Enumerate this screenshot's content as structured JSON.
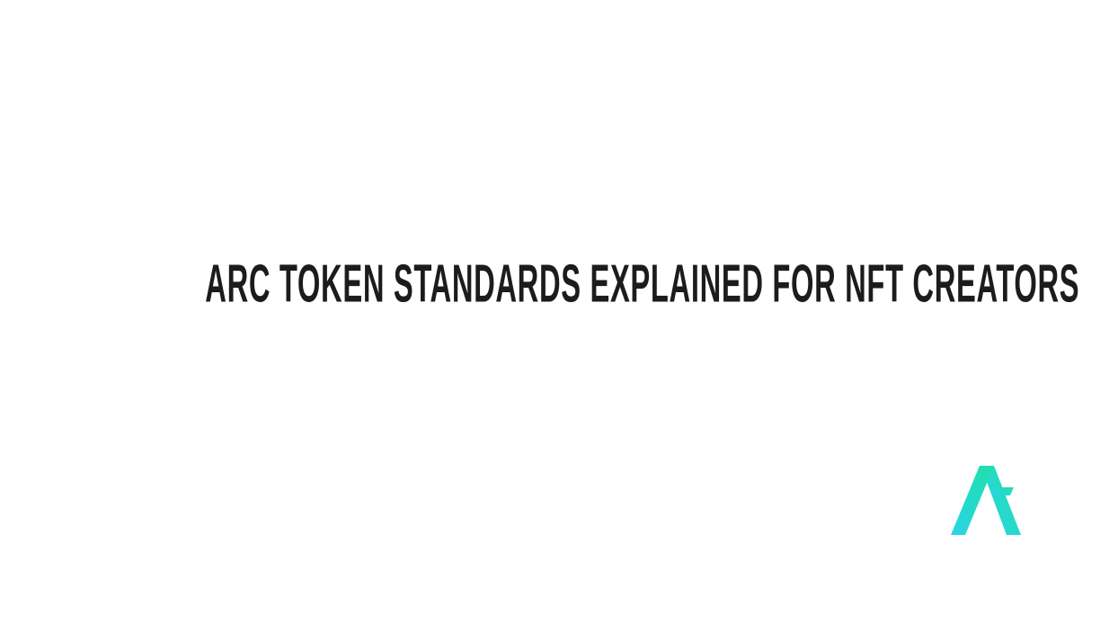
{
  "slide": {
    "title": "ARC TOKEN STANDARDS EXPLAINED FOR NFT CREATORS"
  },
  "logo": {
    "icon": "algorand-logo-icon",
    "gradient_start": "#2ad4e8",
    "gradient_end": "#1fe0a6"
  }
}
